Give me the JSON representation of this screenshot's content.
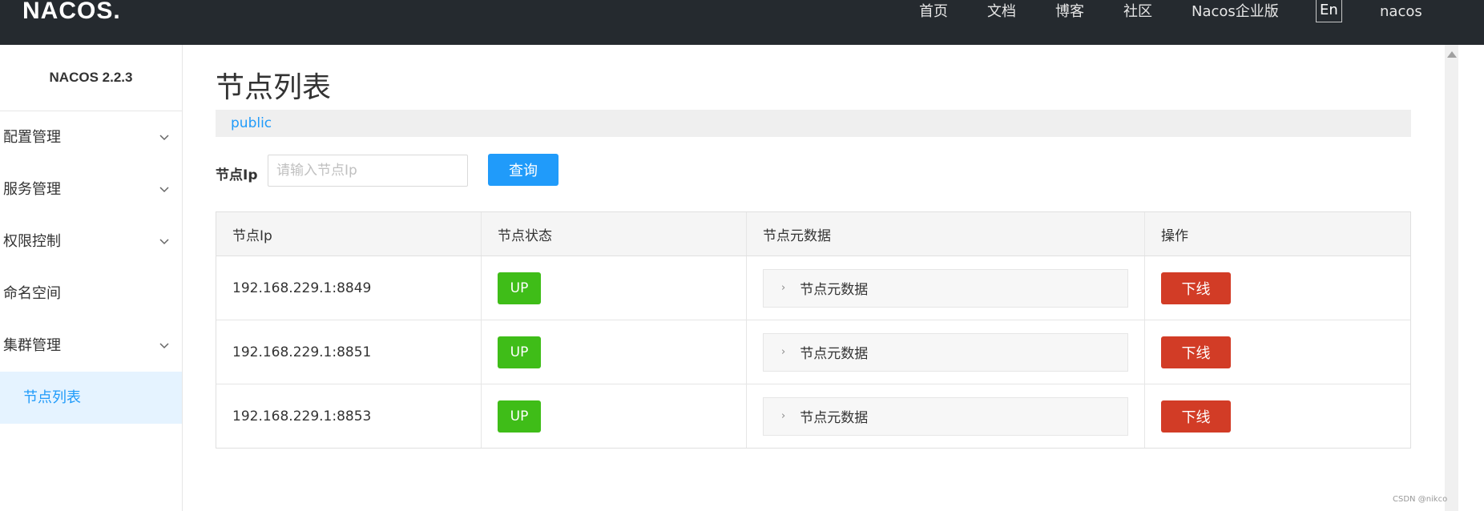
{
  "header": {
    "logo": "NACOS.",
    "nav": [
      "首页",
      "文档",
      "博客",
      "社区",
      "Nacos企业版"
    ],
    "lang": "En",
    "user": "nacos"
  },
  "sidebar": {
    "version": "NACOS 2.2.3",
    "items": [
      {
        "label": "配置管理",
        "expandable": true
      },
      {
        "label": "服务管理",
        "expandable": true
      },
      {
        "label": "权限控制",
        "expandable": true
      },
      {
        "label": "命名空间",
        "expandable": false
      },
      {
        "label": "集群管理",
        "expandable": true
      },
      {
        "label": "节点列表",
        "active": true
      }
    ]
  },
  "main": {
    "title": "节点列表",
    "namespace": "public",
    "search": {
      "label": "节点Ip",
      "placeholder": "请输入节点Ip",
      "value": "",
      "button": "查询"
    },
    "table": {
      "headers": [
        "节点Ip",
        "节点状态",
        "节点元数据",
        "操作"
      ],
      "rows": [
        {
          "ip": "192.168.229.1:8849",
          "status": "UP",
          "meta": "节点元数据",
          "action": "下线"
        },
        {
          "ip": "192.168.229.1:8851",
          "status": "UP",
          "meta": "节点元数据",
          "action": "下线"
        },
        {
          "ip": "192.168.229.1:8853",
          "status": "UP",
          "meta": "节点元数据",
          "action": "下线"
        }
      ]
    }
  },
  "watermark": "CSDN @nikco",
  "colors": {
    "header_bg": "#252a2f",
    "primary": "#209bfa",
    "status_up": "#3fbd18",
    "danger": "#d23c26",
    "active_menu_bg": "#e5f3ff"
  }
}
